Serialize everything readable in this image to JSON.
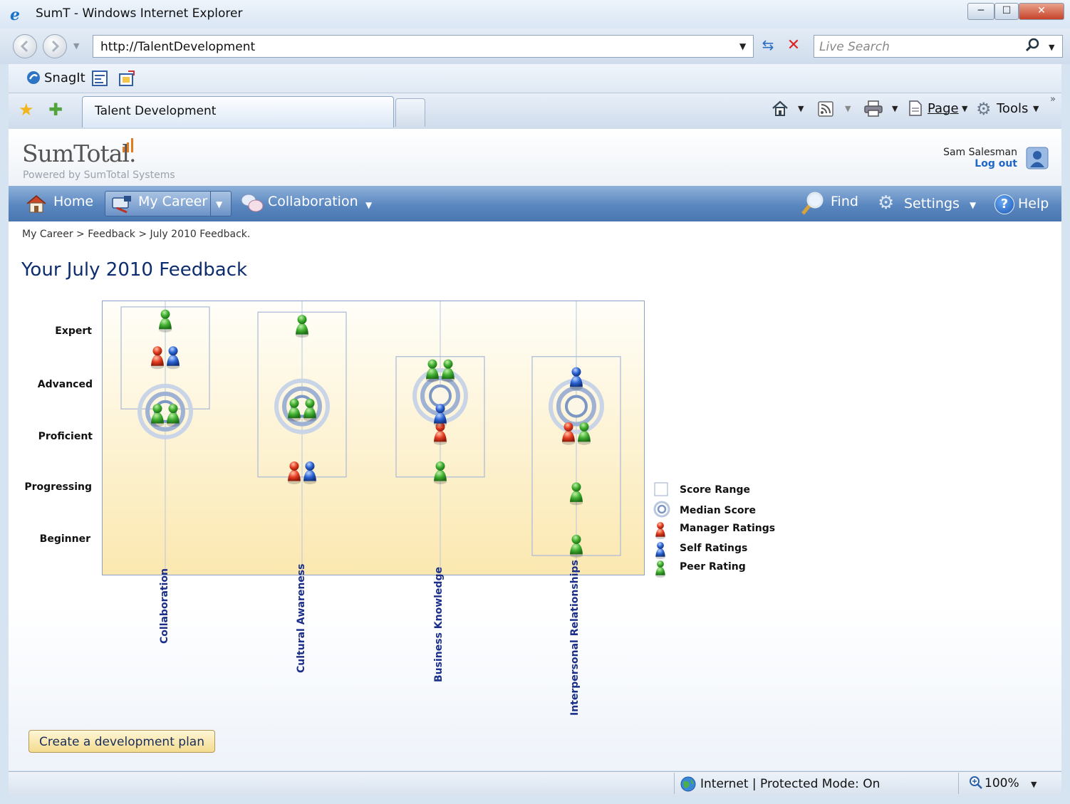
{
  "window": {
    "title": "SumT  - Windows Internet Explorer",
    "minimize": "─",
    "maximize": "☐",
    "close": "✕"
  },
  "address_bar": {
    "url": "http://TalentDevelopment",
    "search_placeholder": "Live Search"
  },
  "links_bar": {
    "snagit_label": "SnagIt"
  },
  "tabs": {
    "active_label": "Talent Development"
  },
  "command_bar": {
    "page_label": "Page",
    "tools_label": "Tools"
  },
  "app": {
    "logo_text": "SumTotal.",
    "logo_sub": "Powered by SumTotal Systems",
    "user_name": "Sam Salesman",
    "logout_label": "Log out",
    "nav": {
      "home": "Home",
      "my_career": "My Career",
      "collaboration": "Collaboration",
      "find": "Find",
      "settings": "Settings",
      "help": "Help"
    },
    "breadcrumb": "My Career > Feedback > July 2010 Feedback.",
    "page_title": "Your July 2010 Feedback",
    "create_plan_label": "Create a development plan"
  },
  "chart_data": {
    "type": "scatter",
    "y_levels": [
      "Beginner",
      "Progressing",
      "Proficient",
      "Advanced",
      "Expert"
    ],
    "categories": [
      "Collaboration",
      "Cultural Awareness",
      "Business Knowledge",
      "Interpersonal Relationships"
    ],
    "score_range": [
      {
        "category": "Collaboration",
        "min": 3.5,
        "max": 5.45
      },
      {
        "category": "Cultural Awareness",
        "min": 2.2,
        "max": 5.35
      },
      {
        "category": "Business Knowledge",
        "min": 2.2,
        "max": 4.5
      },
      {
        "category": "Interpersonal Relationships",
        "min": 0.7,
        "max": 4.5
      }
    ],
    "median": [
      {
        "category": "Collaboration",
        "value": 3.45
      },
      {
        "category": "Cultural Awareness",
        "value": 3.55
      },
      {
        "category": "Business Knowledge",
        "value": 3.75
      },
      {
        "category": "Interpersonal Relationships",
        "value": 3.55
      }
    ],
    "series": [
      {
        "name": "Manager Ratings",
        "color": "#e0311f",
        "points": [
          {
            "category": "Collaboration",
            "value": 4.5
          },
          {
            "category": "Cultural Awareness",
            "value": 2.3
          },
          {
            "category": "Business Knowledge",
            "value": 3.05
          },
          {
            "category": "Interpersonal Relationships",
            "value": 3.05
          }
        ]
      },
      {
        "name": "Self Ratings",
        "color": "#1f58c8",
        "points": [
          {
            "category": "Collaboration",
            "value": 4.5
          },
          {
            "category": "Cultural Awareness",
            "value": 2.3
          },
          {
            "category": "Business Knowledge",
            "value": 3.4
          },
          {
            "category": "Interpersonal Relationships",
            "value": 4.1
          }
        ]
      },
      {
        "name": "Peer Rating",
        "color": "#2fa32c",
        "points": [
          {
            "category": "Collaboration",
            "value": 5.2
          },
          {
            "category": "Collaboration",
            "value": 3.4
          },
          {
            "category": "Collaboration",
            "value": 3.4
          },
          {
            "category": "Cultural Awareness",
            "value": 5.1
          },
          {
            "category": "Cultural Awareness",
            "value": 3.5
          },
          {
            "category": "Cultural Awareness",
            "value": 3.5
          },
          {
            "category": "Business Knowledge",
            "value": 4.25
          },
          {
            "category": "Business Knowledge",
            "value": 4.25
          },
          {
            "category": "Business Knowledge",
            "value": 2.3
          },
          {
            "category": "Interpersonal Relationships",
            "value": 3.05
          },
          {
            "category": "Interpersonal Relationships",
            "value": 1.9
          },
          {
            "category": "Interpersonal Relationships",
            "value": 0.9
          }
        ]
      }
    ],
    "legend": {
      "position": "right",
      "entries": [
        "Score Range",
        "Median Score",
        "Manager Ratings",
        "Self Ratings",
        "Peer Rating"
      ]
    }
  },
  "status_bar": {
    "zone": "Internet | Protected Mode: On",
    "zoom": "100%"
  },
  "icons": {
    "favorites": "star-icon",
    "add_favorites": "add-favorites-icon",
    "home": "home-icon",
    "feeds": "rss-icon",
    "print": "printer-icon",
    "find": "magnifier-icon",
    "settings": "gears-icon",
    "help": "help-icon",
    "user": "user-avatar-icon",
    "globe": "globe-icon"
  }
}
